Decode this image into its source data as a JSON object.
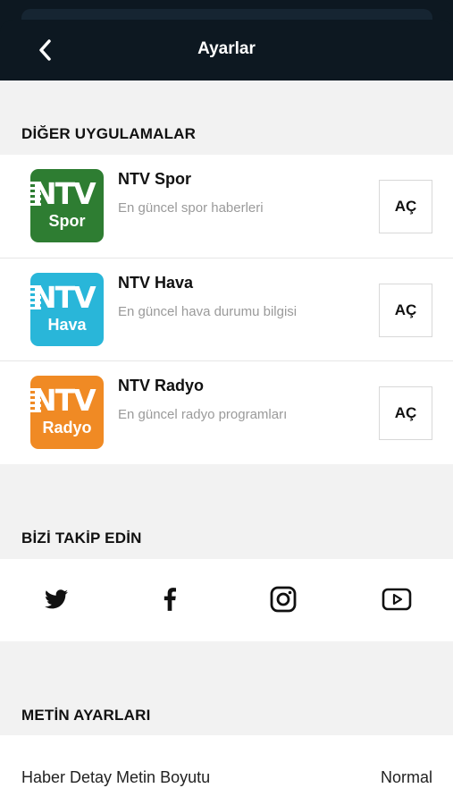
{
  "header": {
    "title": "Ayarlar",
    "back_icon": "chevron-left-icon",
    "background": "#0d1821"
  },
  "other_apps": {
    "title": "DİĞER UYGULAMALAR",
    "items": [
      {
        "name": "NTV Spor",
        "description": "En güncel spor haberleri",
        "logo_text": "NTV",
        "logo_sub": "Spor",
        "color": "#2e7d32",
        "button": "AÇ"
      },
      {
        "name": "NTV Hava",
        "description": "En güncel hava durumu bilgisi",
        "logo_text": "NTV",
        "logo_sub": "Hava",
        "color": "#29b6d9",
        "button": "AÇ"
      },
      {
        "name": "NTV Radyo",
        "description": "En güncel radyo programları",
        "logo_text": "NTV",
        "logo_sub": "Radyo",
        "color": "#f08a24",
        "button": "AÇ"
      }
    ]
  },
  "follow": {
    "title": "BİZİ TAKİP EDİN",
    "icons": [
      "twitter-icon",
      "facebook-icon",
      "instagram-icon",
      "youtube-icon"
    ]
  },
  "text_settings": {
    "title": "METİN AYARLARI",
    "label": "Haber Detay Metin Boyutu",
    "value": "Normal"
  }
}
